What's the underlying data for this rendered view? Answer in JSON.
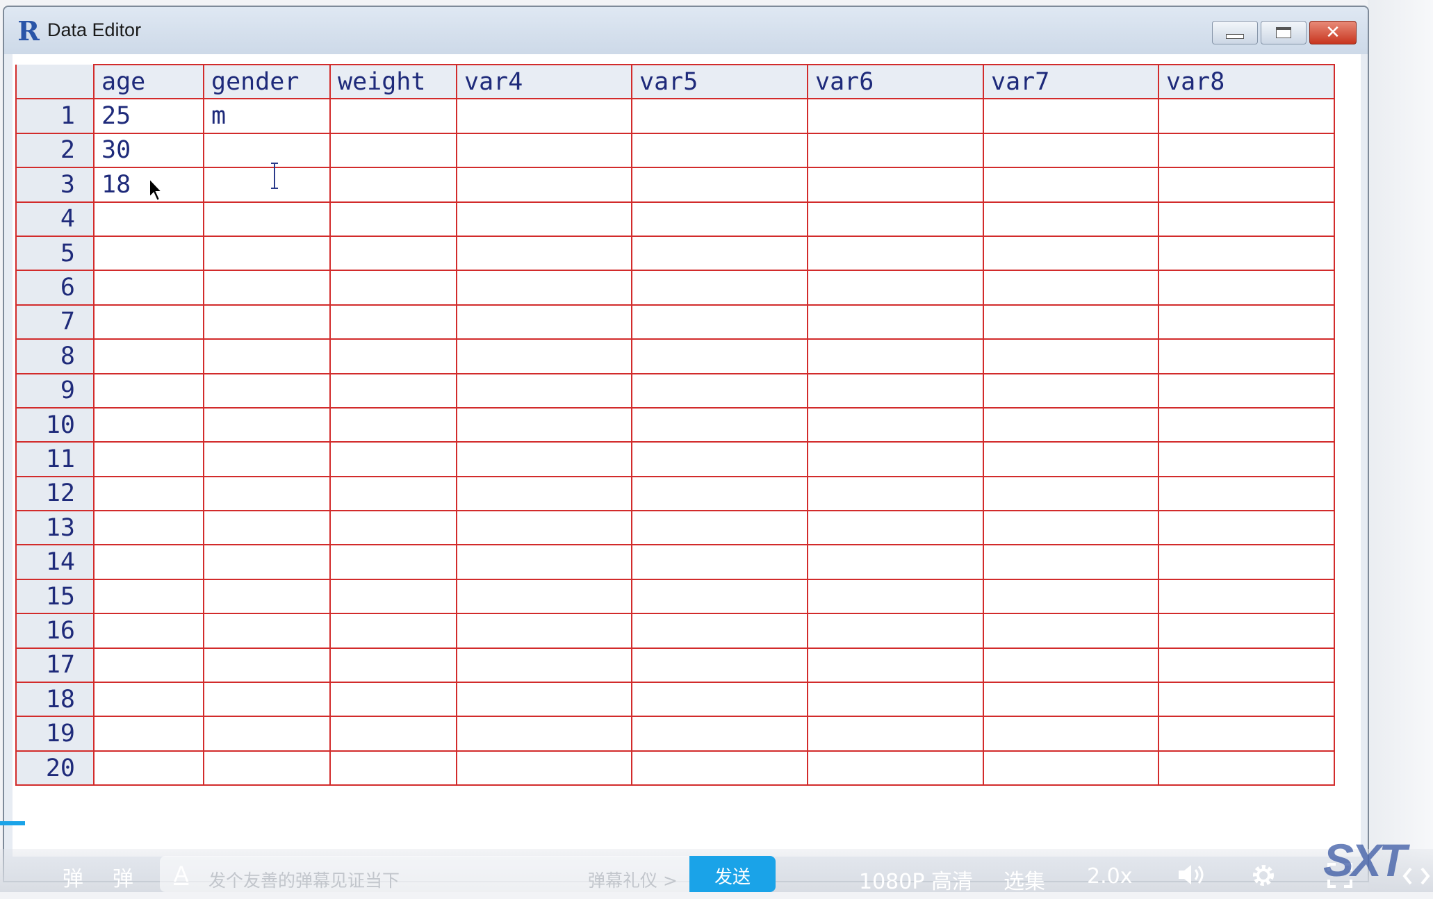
{
  "window": {
    "title": "Data Editor",
    "controls": {
      "minimize": "",
      "maximize": "",
      "close": "✕"
    }
  },
  "grid": {
    "columns": [
      "age",
      "gender",
      "weight",
      "var4",
      "var5",
      "var6",
      "var7",
      "var8"
    ],
    "row_numbers": [
      "1",
      "2",
      "3",
      "4",
      "5",
      "6",
      "7",
      "8",
      "9",
      "10",
      "11",
      "12",
      "13",
      "14",
      "15",
      "16",
      "17",
      "18",
      "19",
      "20"
    ],
    "rows": [
      [
        "25",
        "m",
        "",
        "",
        "",
        "",
        "",
        ""
      ],
      [
        "30",
        "",
        "",
        "",
        "",
        "",
        "",
        ""
      ],
      [
        "18",
        "",
        "",
        "",
        "",
        "",
        "",
        ""
      ]
    ]
  },
  "player": {
    "danmu_icon_1": "弹",
    "danmu_icon_2": "弹",
    "danmu_style_glyph": "A",
    "danmu_placeholder": "发个友善的弹幕见证当下",
    "danmu_etiquette": "弹幕礼仪 >",
    "send_label": "发送",
    "quality": "1080P 高清",
    "episodes": "选集",
    "speed": "2.0x",
    "watermark": "SXT",
    "colors": {
      "accent": "#1aa3e8",
      "grid_line": "#d22b2b",
      "cell_text": "#1e2a7a"
    }
  }
}
